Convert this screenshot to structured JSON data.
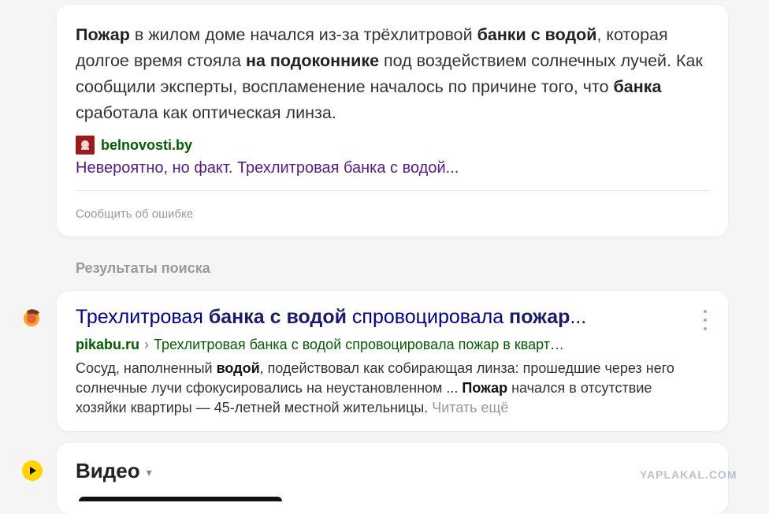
{
  "snippet": {
    "text": [
      {
        "t": "Пожар",
        "b": true
      },
      {
        "t": " в жилом доме начался из-за трёхлитровой ",
        "b": false
      },
      {
        "t": "банки с водой",
        "b": true
      },
      {
        "t": ", которая долгое время стояла ",
        "b": false
      },
      {
        "t": "на подоконнике",
        "b": true
      },
      {
        "t": " под воздействием солнечных лучей. Как сообщили эксперты, воспламенение началось по причине того, что ",
        "b": false
      },
      {
        "t": "банка",
        "b": true
      },
      {
        "t": " сработала как оптическая линза.",
        "b": false
      }
    ],
    "source_name": "belnovosti.by",
    "link_text": "Невероятно, но факт. Трехлитровая банка с водой...",
    "report_label": "Сообщить об ошибке"
  },
  "results_heading": "Результаты поиска",
  "result": {
    "title_parts": [
      {
        "t": "Трехлитровая ",
        "b": false
      },
      {
        "t": "банка с водой",
        "b": true
      },
      {
        "t": " спровоцировала ",
        "b": false
      },
      {
        "t": "пожар",
        "b": true
      },
      {
        "t": "...",
        "b": false
      }
    ],
    "domain": "pikabu.ru",
    "separator": "›",
    "path": "Трехлитровая банка с водой спровоцировала пожар в кварт…",
    "snippet_parts": [
      {
        "t": "Сосуд, наполненный ",
        "b": false
      },
      {
        "t": "водой",
        "b": true
      },
      {
        "t": ", подействовал как собирающая линза: прошедшие через него солнечные лучи сфокусировались на неустановленном ... ",
        "b": false
      },
      {
        "t": "Пожар",
        "b": true
      },
      {
        "t": " начался в отсутствие хозяйки квартиры — 45-летней местной жительницы. ",
        "b": false
      }
    ],
    "read_more": "Читать ещё",
    "site_icon": "pikabu-icon",
    "more_icon": "more-vertical-icon"
  },
  "video": {
    "title": "Видео",
    "caret": "▾",
    "icon": "play-icon"
  },
  "watermark": "YAPLAKAL.COM",
  "colors": {
    "background": "#f5f5f6",
    "title_link": "#000096",
    "visited_link": "#551a8b",
    "url_green": "#006000",
    "muted": "#999999",
    "video_icon": "#ffd400"
  }
}
